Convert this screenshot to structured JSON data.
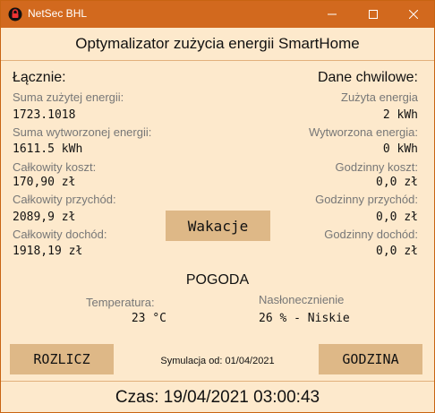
{
  "window": {
    "title": "NetSec BHL",
    "controls": [
      "minimize",
      "maximize",
      "close"
    ]
  },
  "header": {
    "title": "Optymalizator zużycia energii SmartHome"
  },
  "totals": {
    "section_title": "Łącznie:",
    "energy_used_label": "Suma zużytej energii:",
    "energy_used_value": "1723.1018",
    "energy_produced_label": "Suma wytworzonej energii:",
    "energy_produced_value": "1611.5 kWh",
    "total_cost_label": "Całkowity koszt:",
    "total_cost_value": "170,90 zł",
    "total_revenue_label": "Całkowity przychód:",
    "total_revenue_value": "2089,9 zł",
    "total_income_label": "Całkowity dochód:",
    "total_income_value": "1918,19 zł"
  },
  "current": {
    "section_title": "Dane chwilowe:",
    "energy_used_label": "Zużyta energia",
    "energy_used_value": "2 kWh",
    "energy_produced_label": "Wytworzona energia:",
    "energy_produced_value": "0 kWh",
    "hourly_cost_label": "Godzinny koszt:",
    "hourly_cost_value": "0,0 zł",
    "hourly_revenue_label": "Godzinny przychód:",
    "hourly_revenue_value": "0,0 zł",
    "hourly_income_label": "Godzinny dochód:",
    "hourly_income_value": "0,0 zł"
  },
  "vacation_button": "Wakacje",
  "weather": {
    "title": "POGODA",
    "temperature_label": "Temperatura:",
    "temperature_value": "23 °C",
    "insolation_label": "Nasłonecznienie",
    "insolation_value": "26 % - Niskie"
  },
  "actions": {
    "settle_button": "ROZLICZ",
    "hour_button": "GODZINA",
    "simulation_since": "Symulacja od: 01/04/2021"
  },
  "footer": {
    "time": "Czas: 19/04/2021 03:00:43"
  },
  "colors": {
    "titlebar": "#d2691e",
    "background": "#fde9cc",
    "button": "#deb887",
    "label": "#777777"
  }
}
